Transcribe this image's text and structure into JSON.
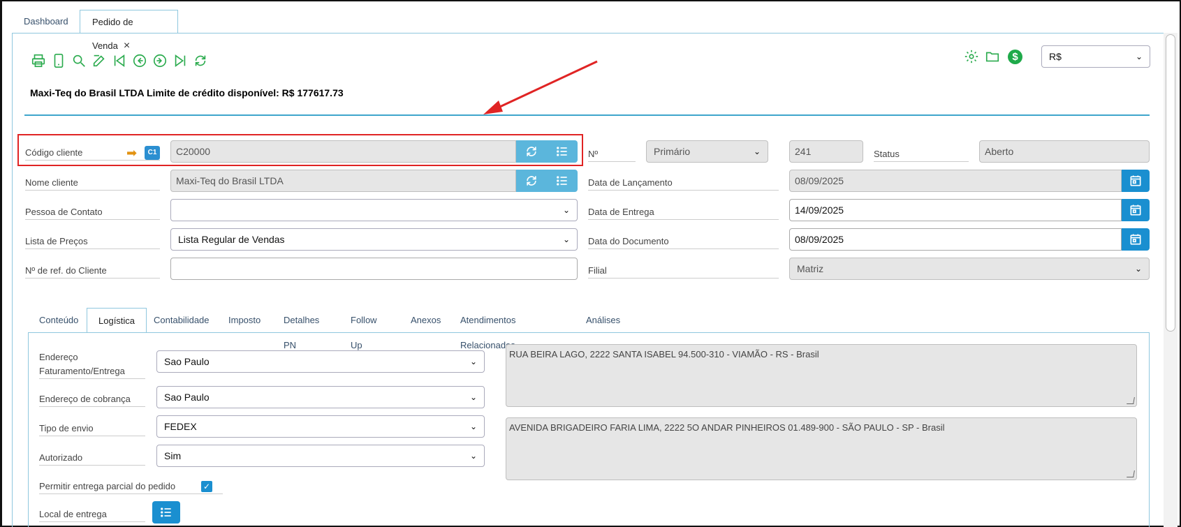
{
  "tabs": [
    {
      "label": "Dashboard"
    },
    {
      "label": "Pedido de Venda",
      "close": "×"
    }
  ],
  "currency": {
    "selected": "R$"
  },
  "credit_line": "Maxi-Teq do Brasil LTDA Limite de crédito disponível: R$ 177617.73",
  "form": {
    "codigo_cliente": {
      "label": "Código cliente",
      "badge": "C1",
      "value": "C20000"
    },
    "nome_cliente": {
      "label": "Nome cliente",
      "value": "Maxi-Teq do Brasil LTDA"
    },
    "pessoa_contato": {
      "label": "Pessoa de Contato",
      "value": ""
    },
    "lista_precos": {
      "label": "Lista de Preços",
      "value": "Lista Regular de Vendas"
    },
    "ref_cliente": {
      "label": "Nº de ref. do Cliente",
      "value": ""
    },
    "numero": {
      "label": "Nº",
      "series": "Primário",
      "value": "241"
    },
    "status": {
      "label": "Status",
      "value": "Aberto"
    },
    "data_lancamento": {
      "label": "Data de Lançamento",
      "value": "08/09/2025"
    },
    "data_entrega": {
      "label": "Data de Entrega",
      "value": "14/09/2025"
    },
    "data_documento": {
      "label": "Data do Documento",
      "value": "08/09/2025"
    },
    "filial": {
      "label": "Filial",
      "value": "Matriz"
    }
  },
  "subtabs": [
    {
      "label": "Conteúdo"
    },
    {
      "label": "Logística"
    },
    {
      "label": "Contabilidade"
    },
    {
      "label": "Imposto"
    },
    {
      "label": "Detalhes PN"
    },
    {
      "label": "Follow Up"
    },
    {
      "label": "Anexos"
    },
    {
      "label": "Atendimentos Relacionados"
    },
    {
      "label": "Análises"
    }
  ],
  "logistica": {
    "end_faturamento": {
      "label_1": "Endereço",
      "label_2": "Faturamento/Entrega",
      "value": "Sao Paulo",
      "address": "RUA BEIRA LAGO, 2222  SANTA ISABEL 94.500-310 - VIAMÃO - RS - Brasil"
    },
    "end_cobranca": {
      "label": "Endereço de cobrança",
      "value": "Sao Paulo",
      "address": "AVENIDA BRIGADEIRO FARIA LIMA, 2222 5O ANDAR PINHEIROS 01.489-900 - SÃO PAULO - SP - Brasil"
    },
    "tipo_envio": {
      "label": "Tipo de envio",
      "value": "FEDEX"
    },
    "autorizado": {
      "label": "Autorizado",
      "value": "Sim"
    },
    "entrega_parcial": {
      "label": "Permitir entrega parcial do pedido",
      "check": "✓"
    },
    "local_entrega": {
      "label": "Local de entrega"
    }
  },
  "icons": {
    "chevron": "⌄",
    "orange_arrow": "➡"
  },
  "colors": {
    "accent": "#3ea5cc",
    "green": "#2bab4e",
    "button": "#5bb6dc",
    "button_dark": "#1a8fd0",
    "highlight": "#e02424"
  }
}
